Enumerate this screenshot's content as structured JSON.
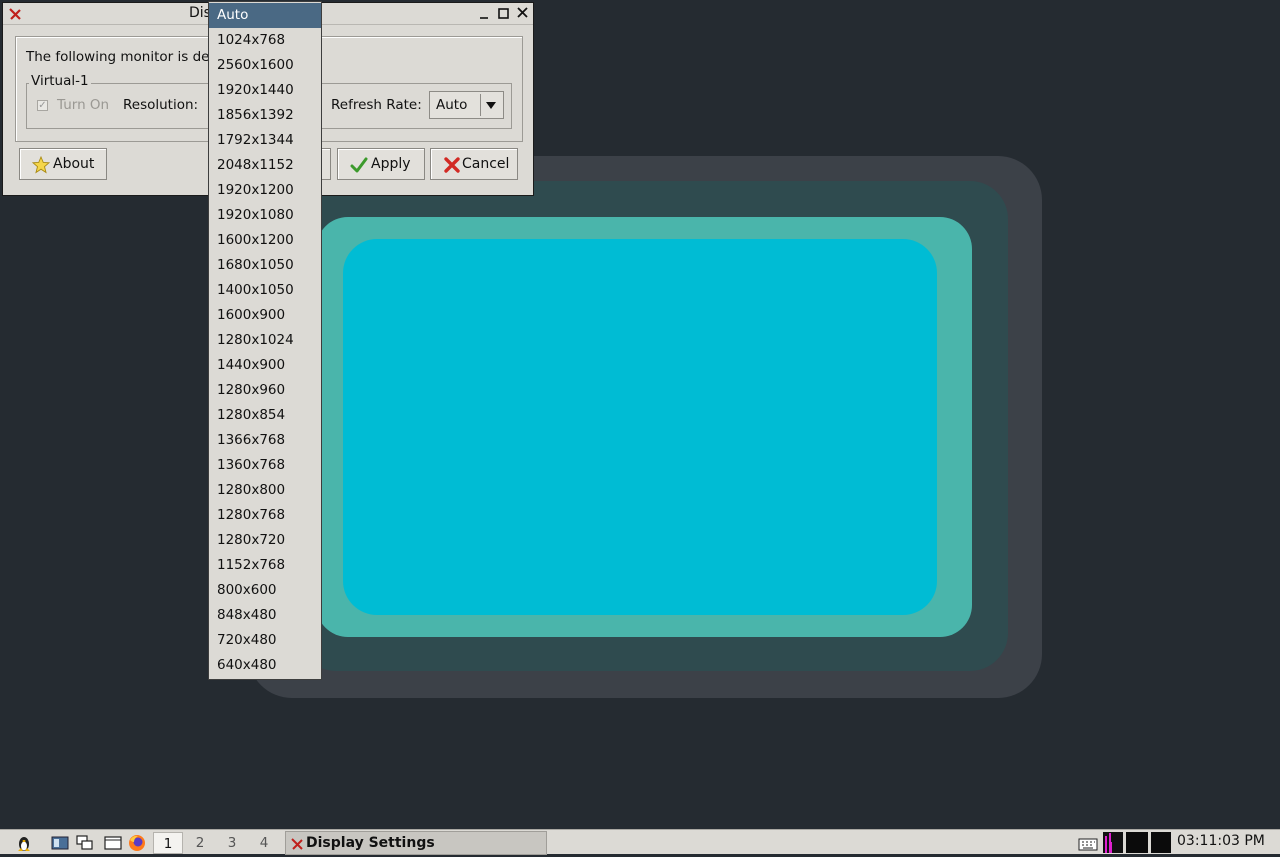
{
  "window": {
    "title": "Dis",
    "detected_text": "The following monitor is de",
    "monitor_name": "Virtual-1",
    "turn_on_label": "Turn On",
    "turn_on_checked": true,
    "resolution_label": "Resolution:",
    "refresh_rate_label": "Refresh Rate:",
    "refresh_rate_value": "Auto",
    "buttons": {
      "about": "About",
      "apply": "Apply",
      "cancel": "Cancel"
    }
  },
  "resolution_dropdown": {
    "selected": "Auto",
    "options": [
      "Auto",
      "1024x768",
      "2560x1600",
      "1920x1440",
      "1856x1392",
      "1792x1344",
      "2048x1152",
      "1920x1200",
      "1920x1080",
      "1600x1200",
      "1680x1050",
      "1400x1050",
      "1600x900",
      "1280x1024",
      "1440x900",
      "1280x960",
      "1280x854",
      "1366x768",
      "1360x768",
      "1280x800",
      "1280x768",
      "1280x720",
      "1152x768",
      "800x600",
      "848x480",
      "720x480",
      "640x480"
    ]
  },
  "taskbar": {
    "workspaces": [
      "1",
      "2",
      "3",
      "4"
    ],
    "active_workspace": "1",
    "task_title": "Display Settings",
    "clock": "03:11:03 PM"
  },
  "colors": {
    "desktop_bg": "#252b31",
    "wallpaper_cyan": "#00bcd4",
    "wallpaper_teal": "#4ab5ab",
    "selection": "#4a6984",
    "window_bg": "#dcdad5"
  }
}
